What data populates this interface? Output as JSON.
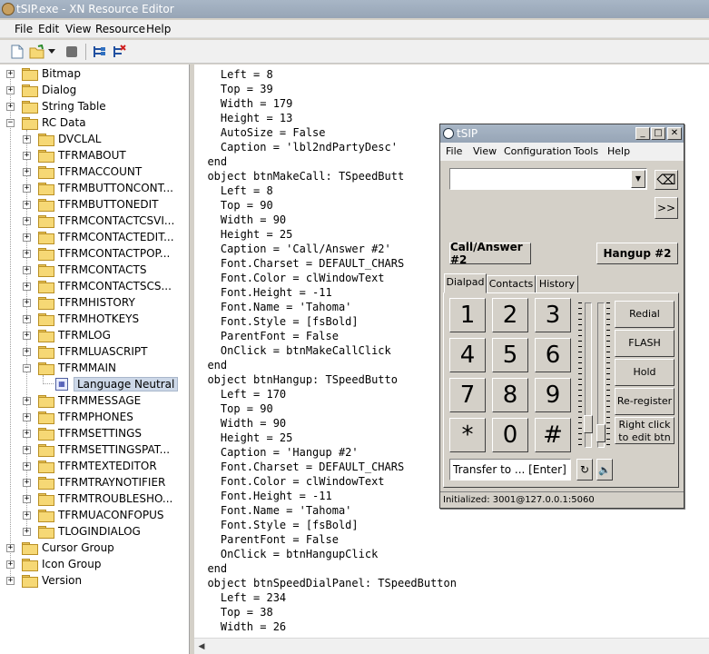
{
  "window": {
    "title": "tSIP.exe - XN Resource Editor"
  },
  "menu": [
    "File",
    "Edit",
    "View",
    "Resource",
    "Help"
  ],
  "toolbar": {
    "icons": [
      "new-file-icon",
      "open-icon",
      "dropdown-arrow-icon",
      "stop-icon",
      "add-resource-icon",
      "delete-resource-icon"
    ]
  },
  "tree": {
    "root_items": [
      "Bitmap",
      "Dialog",
      "String Table",
      "RC Data",
      "Cursor Group",
      "Icon Group",
      "Version"
    ],
    "rc_data_children": [
      "DVCLAL",
      "TFRMABOUT",
      "TFRMACCOUNT",
      "TFRMBUTTONCONT...",
      "TFRMBUTTONEDIT",
      "TFRMCONTACTCSVI...",
      "TFRMCONTACTEDIT...",
      "TFRMCONTACTPOP...",
      "TFRMCONTACTS",
      "TFRMCONTACTSCS...",
      "TFRMHISTORY",
      "TFRMHOTKEYS",
      "TFRMLOG",
      "TFRMLUASCRIPT",
      "TFRMMAIN",
      "TFRMMESSAGE",
      "TFRMPHONES",
      "TFRMSETTINGS",
      "TFRMSETTINGSPAT...",
      "TFRMTEXTEDITOR",
      "TFRMTRAYNOTIFIER",
      "TFRMTROUBLESHO...",
      "TFRMUACONFOPUS",
      "TLOGINDIALOG"
    ],
    "selected_child": "Language Neutral"
  },
  "code_lines": [
    "    Left = 8",
    "    Top = 39",
    "    Width = 179",
    "    Height = 13",
    "    AutoSize = False",
    "    Caption = 'lbl2ndPartyDesc'",
    "  end",
    "  object btnMakeCall: TSpeedButt",
    "    Left = 8",
    "    Top = 90",
    "    Width = 90",
    "    Height = 25",
    "    Caption = 'Call/Answer #2'",
    "    Font.Charset = DEFAULT_CHARS",
    "    Font.Color = clWindowText",
    "    Font.Height = -11",
    "    Font.Name = 'Tahoma'",
    "    Font.Style = [fsBold]",
    "    ParentFont = False",
    "    OnClick = btnMakeCallClick",
    "  end",
    "  object btnHangup: TSpeedButto",
    "    Left = 170",
    "    Top = 90",
    "    Width = 90",
    "    Height = 25",
    "    Caption = 'Hangup #2'",
    "    Font.Charset = DEFAULT_CHARS",
    "    Font.Color = clWindowText",
    "    Font.Height = -11",
    "    Font.Name = 'Tahoma'",
    "    Font.Style = [fsBold]",
    "    ParentFont = False",
    "    OnClick = btnHangupClick",
    "  end",
    "  object btnSpeedDialPanel: TSpeedButton",
    "    Left = 234",
    "    Top = 38",
    "    Width = 26"
  ],
  "tsip": {
    "title": "tSIP",
    "menu": [
      "File",
      "View",
      "Configuration",
      "Tools",
      "Help"
    ],
    "number_value": "",
    "backspace_symbol": "⌫",
    "forward_symbol": ">>",
    "call_answer": "Call/Answer #2",
    "hangup": "Hangup #2",
    "tabs": [
      "Dialpad",
      "Contacts",
      "History"
    ],
    "keys": [
      "1",
      "2",
      "3",
      "4",
      "5",
      "6",
      "7",
      "8",
      "9",
      "*",
      "0",
      "#"
    ],
    "side_buttons": [
      "Redial",
      "FLASH",
      "Hold",
      "Re-register"
    ],
    "right_click_hint_line1": "Right click",
    "right_click_hint_line2": "to edit btn",
    "transfer_placeholder": "Transfer to ... [Enter]",
    "status": "Initialized: 3001@127.0.0.1:5060"
  }
}
